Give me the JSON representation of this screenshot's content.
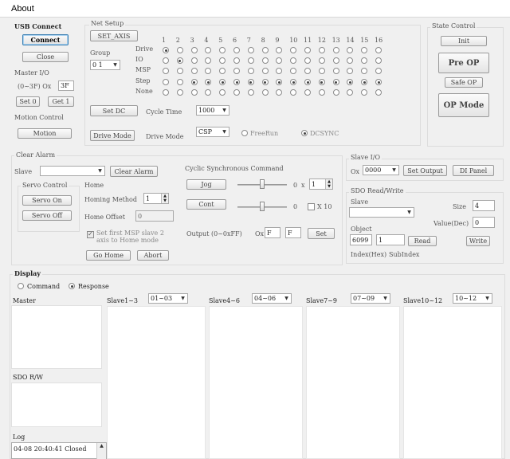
{
  "window": {
    "title": "About"
  },
  "usb": {
    "title": "USB Connect",
    "connect": "Connect",
    "close": "Close"
  },
  "net_setup": {
    "title": "Net Setup",
    "set_axis": "SET_AXIS",
    "group_label": "Group",
    "group_value": "0 1",
    "row_labels": [
      "Drive",
      "IO",
      "MSP",
      "Step",
      "None"
    ],
    "columns": [
      "1",
      "2",
      "3",
      "4",
      "5",
      "6",
      "7",
      "8",
      "9",
      "10",
      "11",
      "12",
      "13",
      "14",
      "15",
      "16"
    ],
    "set_dc": "Set DC",
    "cycle_time_label": "Cycle Time",
    "cycle_time_value": "1000",
    "drive_mode_btn": "Drive Mode",
    "drive_mode_label": "Drive Mode",
    "drive_mode_value": "CSP",
    "freerun": "FreeRun",
    "dcsync": "DCSYNC"
  },
  "master_io": {
    "title": "Master I/O",
    "label": "(0~3F) Ox",
    "value": "3F",
    "set0": "Set 0",
    "get1": "Get 1"
  },
  "motion": {
    "title": "Motion Control",
    "button": "Motion"
  },
  "state": {
    "title": "State Control",
    "init": "Init",
    "preop": "Pre OP",
    "safeop": "Safe OP",
    "op": "OP Mode"
  },
  "clear_alarm": {
    "title": "Clear Alarm",
    "slave_label": "Slave",
    "button": "Clear Alarm"
  },
  "servo": {
    "title": "Servo Control",
    "on": "Servo On",
    "off": "Servo Off"
  },
  "home": {
    "title": "Home",
    "method_label": "Homing Method",
    "method_value": "1",
    "offset_label": "Home Offset",
    "offset_value": "0",
    "check_label": "Set first MSP slave 2 axis to Home mode",
    "go": "Go Home",
    "abort": "Abort"
  },
  "csc": {
    "title": "Cyclic Synchronous Command",
    "jog": "Jog",
    "cont": "Cont",
    "jog_val": "0",
    "x_label": "x",
    "mult": "1",
    "cont_val": "0",
    "x10": "X 10",
    "output_label": "Output (0~0xFF)",
    "ox": "Ox",
    "out1": "F",
    "out2": "F",
    "set": "Set"
  },
  "slave_io": {
    "title": "Slave I/O",
    "ox": "Ox",
    "value": "0000",
    "set_output": "Set Output",
    "di_panel": "DI Panel"
  },
  "sdo": {
    "title": "SDO Read/Write",
    "slave_label": "Slave",
    "size_label": "Size",
    "size_value": "4",
    "value_label": "Value(Dec)",
    "value_value": "0",
    "object_label": "Object",
    "index_value": "6099",
    "subindex_value": "1",
    "read": "Read",
    "write": "Write",
    "index_hex": "Index(Hex)",
    "subindex": "SubIndex"
  },
  "display": {
    "title": "Display",
    "command": "Command",
    "response": "Response",
    "master": "Master",
    "slave1_label": "Slave1~3",
    "slave1_value": "01~03",
    "slave2_label": "Slave4~6",
    "slave2_value": "04~06",
    "slave3_label": "Slave7~9",
    "slave3_value": "07~09",
    "slave4_label": "Slave10~12",
    "slave4_value": "10~12",
    "sdo_rw": "SDO R/W",
    "log": "Log",
    "log_entry": "04-08 20:40:41  Closed"
  }
}
